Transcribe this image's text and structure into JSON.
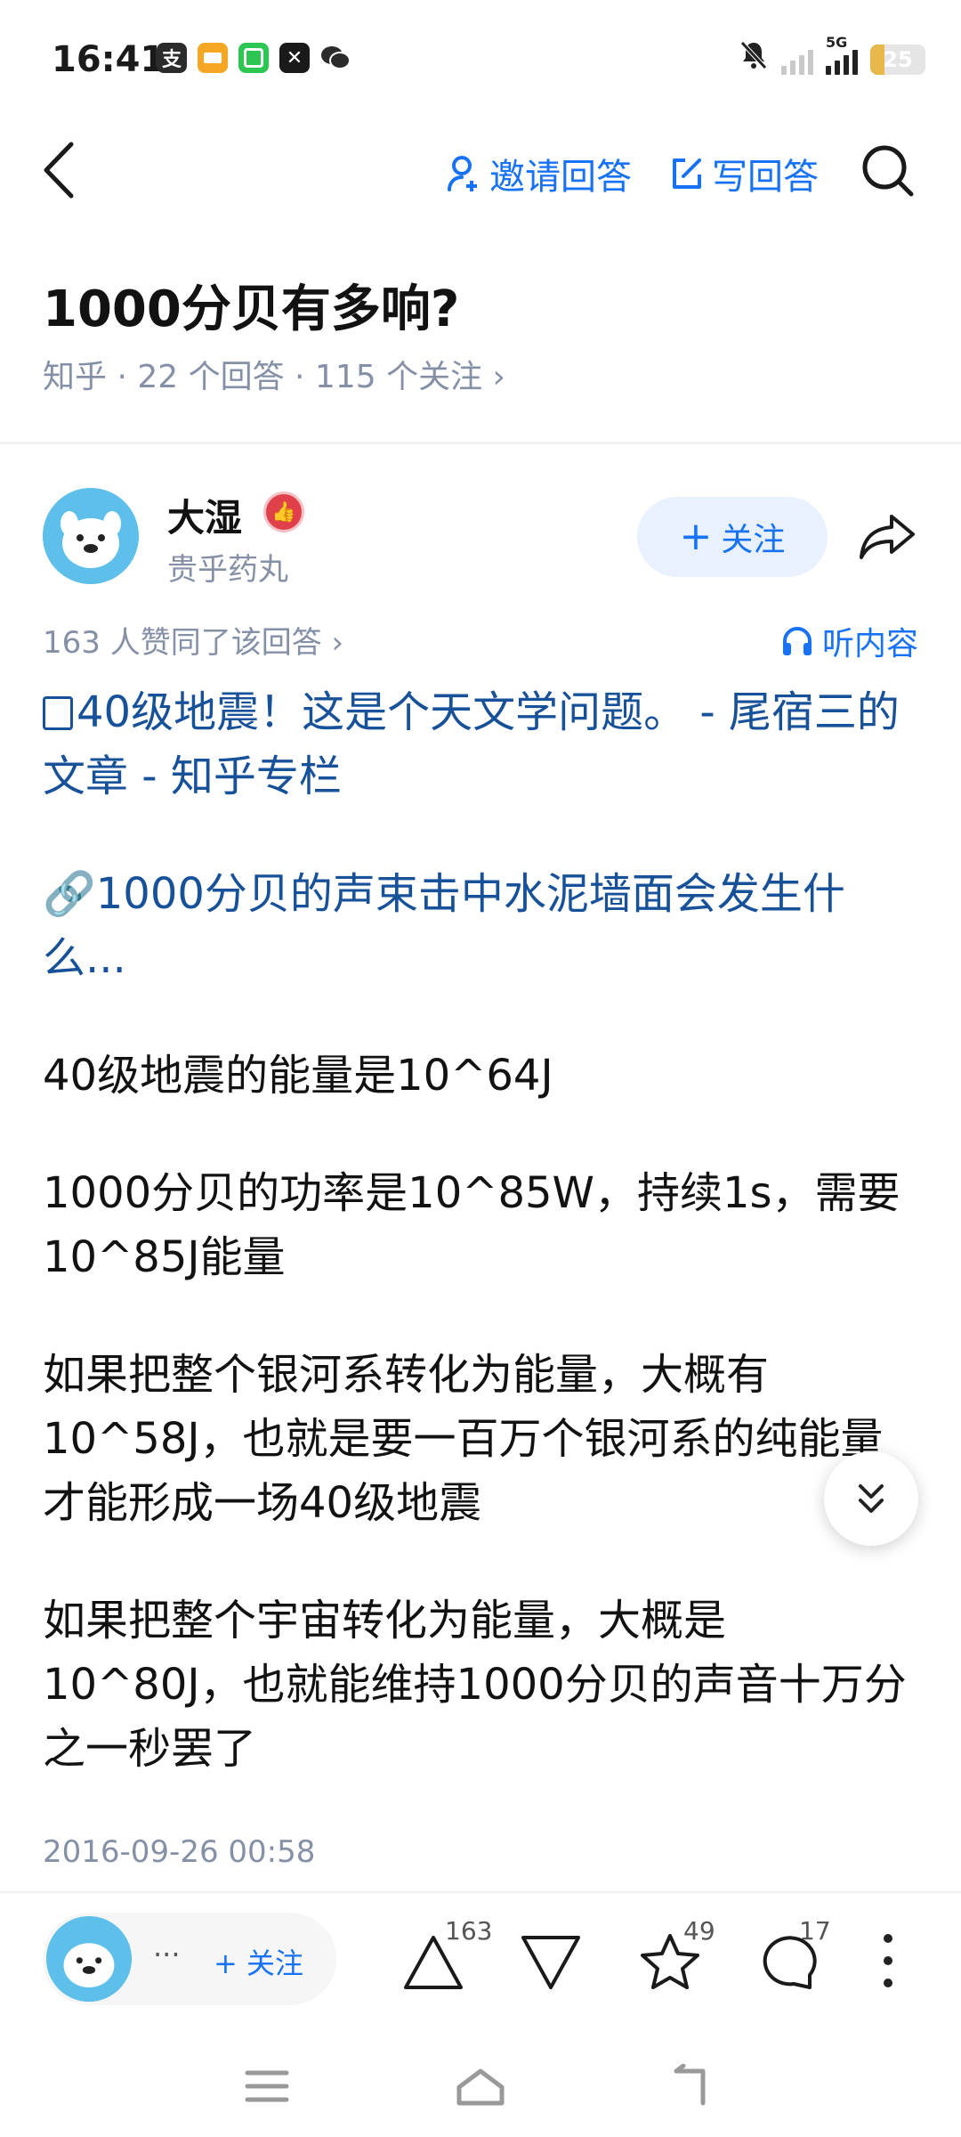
{
  "status_bar": {
    "time": "16:41",
    "apps": [
      {
        "icon": "alipay-icon",
        "glyph": "支",
        "color": "#2b2b2b"
      },
      {
        "icon": "card-icon",
        "glyph": "",
        "color": "#f5a623"
      },
      {
        "icon": "game-icon",
        "glyph": "",
        "color": "#2dc653"
      },
      {
        "icon": "capcut-icon",
        "glyph": "✕",
        "color": "#1a1a1a"
      },
      {
        "icon": "wechat-icon",
        "glyph": "",
        "color": "#2b2b2b"
      }
    ],
    "network": "5G",
    "battery": "25",
    "battery_level": 0.25
  },
  "nav": {
    "invite_label": "邀请回答",
    "write_label": "写回答"
  },
  "question": {
    "title": "1000分贝有多响?",
    "meta": "知乎 · 22 个回答 · 115 个关注 ›"
  },
  "author": {
    "name": "大湿",
    "subtitle": "贵乎药丸",
    "follow_label": "关注"
  },
  "answer": {
    "likes_text": "163 人赞同了该回答 ›",
    "listen_label": "听内容",
    "article_link": "40级地震！这是个天文学问题。 - 尾宿三的文章 - 知乎专栏",
    "web_link": "1000分贝的声束击中水泥墙面会发生什么...",
    "paragraphs": [
      "40级地震的能量是10^64J",
      "1000分贝的功率是10^85W，持续1s，需要10^85J能量",
      "如果把整个银河系转化为能量，大概有10^58J，也就是要一百万个银河系的纯能量才能形成一场40级地震",
      "如果把整个宇宙转化为能量，大概是10^80J，也就能维持1000分贝的声音十万分之一秒罢了"
    ],
    "timestamp": "2016-09-26 00:58"
  },
  "bottom_bar": {
    "mini_dots": "···",
    "mini_follow": "关注",
    "upvote_count": "163",
    "favorite_count": "49",
    "comment_count": "17"
  },
  "colors": {
    "accent": "#1772f6",
    "link": "#175199",
    "meta": "#8590a6"
  }
}
